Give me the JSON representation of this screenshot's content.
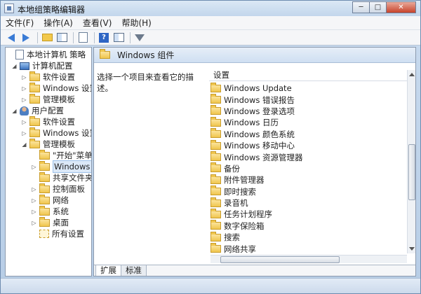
{
  "window": {
    "title": "本地组策略编辑器",
    "controls": {
      "minimize": "─",
      "maximize": "□",
      "close": "✕"
    }
  },
  "menu": [
    "文件(F)",
    "操作(A)",
    "查看(V)",
    "帮助(H)"
  ],
  "toolbar": {
    "icons": [
      "back-arrow-icon",
      "forward-arrow-icon",
      "up-folder-icon",
      "show-hide-tree-icon",
      "export-list-icon",
      "help-icon",
      "properties-pane-icon",
      "filter-icon"
    ],
    "help_glyph": "?"
  },
  "tree": {
    "items": [
      {
        "label": "本地计算机 策略",
        "expander": "",
        "icon": "document-icon"
      },
      {
        "label": "计算机配置",
        "expander": "◢",
        "icon": "computer-icon"
      },
      {
        "label": "软件设置",
        "expander": "▷",
        "icon": "folder-icon"
      },
      {
        "label": "Windows 设置",
        "expander": "▷",
        "icon": "folder-icon"
      },
      {
        "label": "管理模板",
        "expander": "▷",
        "icon": "folder-icon"
      },
      {
        "label": "用户配置",
        "expander": "◢",
        "icon": "user-icon"
      },
      {
        "label": "软件设置",
        "expander": "▷",
        "icon": "folder-icon"
      },
      {
        "label": "Windows 设置",
        "expander": "▷",
        "icon": "folder-icon"
      },
      {
        "label": "管理模板",
        "expander": "◢",
        "icon": "folder-icon"
      },
      {
        "label": "\"开始\"菜单",
        "expander": "",
        "icon": "folder-icon"
      },
      {
        "label": "Windows 组件",
        "expander": "▷",
        "icon": "folder-icon",
        "selected": true
      },
      {
        "label": "共享文件夹",
        "expander": "",
        "icon": "folder-icon"
      },
      {
        "label": "控制面板",
        "expander": "▷",
        "icon": "folder-icon"
      },
      {
        "label": "网络",
        "expander": "▷",
        "icon": "folder-icon"
      },
      {
        "label": "系统",
        "expander": "▷",
        "icon": "folder-icon"
      },
      {
        "label": "桌面",
        "expander": "▷",
        "icon": "folder-icon"
      },
      {
        "label": "所有设置",
        "expander": "",
        "icon": "all-settings-icon"
      }
    ]
  },
  "details": {
    "header": "Windows 组件",
    "description": "选择一个项目来查看它的描述。",
    "column": "设置",
    "items": [
      "Windows Update",
      "Windows 错误报告",
      "Windows 登录选项",
      "Windows 日历",
      "Windows 颜色系统",
      "Windows 移动中心",
      "Windows 资源管理器",
      "备份",
      "附件管理器",
      "即时搜索",
      "录音机",
      "任务计划程序",
      "数字保险箱",
      "搜索",
      "网络共享"
    ],
    "scroll_grip": "⁞⁞⁞"
  },
  "tabs": [
    "扩展",
    "标准"
  ],
  "colors": {
    "accent": "#3a7bd5",
    "folder": "#f0c64e",
    "selection": "#dce9f8"
  }
}
